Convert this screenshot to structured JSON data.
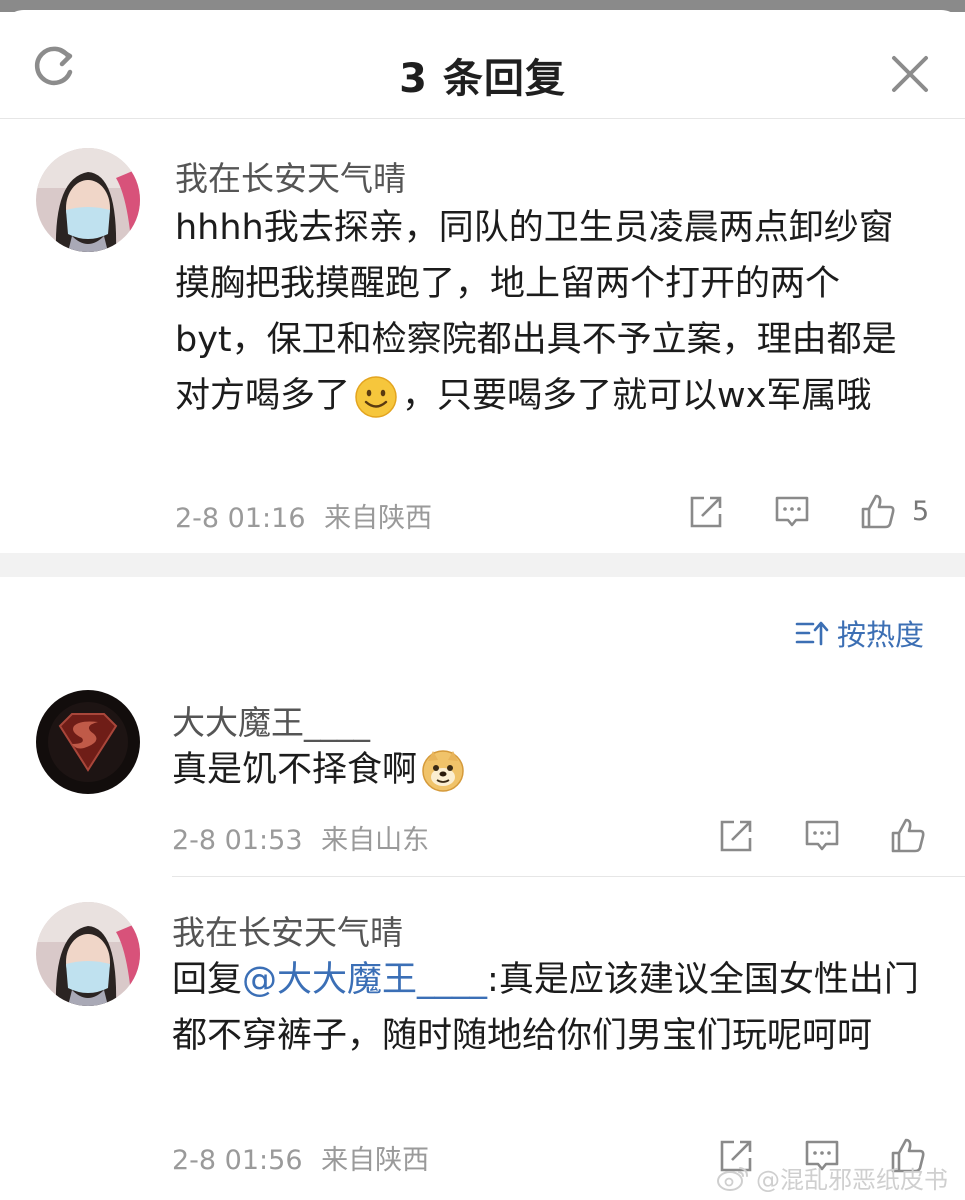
{
  "header": {
    "title": "3 条回复",
    "refresh_icon": "refresh-icon",
    "close_icon": "close-icon"
  },
  "root_comment": {
    "username": "我在长安天气晴",
    "text_parts": [
      "hhhh我去探亲，同队的卫生员凌晨两点卸纱窗摸胸把我摸醒跑了，地上留两个打开的两个byt，保卫和检察院都出具不予立案，理由都是对方喝多了",
      "，只要喝多了就可以wx军属哦"
    ],
    "emoji": "smile-emoji",
    "time": "2-8 01:16",
    "location": "来自陕西",
    "like_count": "5"
  },
  "sort": {
    "label": "按热度",
    "icon": "sort-icon"
  },
  "replies": [
    {
      "username": "大大魔王____",
      "text": "真是饥不择食啊",
      "emoji": "doge-emoji",
      "time": "2-8 01:53",
      "location": "来自山东"
    },
    {
      "username": "我在长安天气晴",
      "reply_prefix": "回复",
      "mention": "@大大魔王____",
      "text": ":真是应该建议全国女性出门都不穿裤子，随时随地给你们男宝们玩呢呵呵",
      "time": "2-8 01:56",
      "location": "来自陕西"
    }
  ],
  "watermark": "@混乱邪恶纸皮书",
  "colors": {
    "accent": "#3b6fb6",
    "meta": "#9a9a9a",
    "divider": "#f2f2f2"
  }
}
